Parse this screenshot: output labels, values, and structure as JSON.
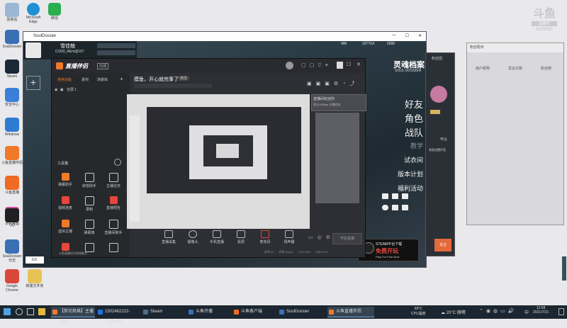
{
  "desktop": {
    "icons": [
      {
        "label": "回收站",
        "color": "#9bb7d4"
      },
      {
        "label": "Microsoft Edge",
        "color": "#1f8fd6"
      },
      {
        "label": "微信",
        "color": "#2aae4f"
      },
      {
        "label": "SoulDossier",
        "color": "#3a6fb5"
      },
      {
        "label": "Steam",
        "color": "#1b2838"
      },
      {
        "label": "安全中心",
        "color": "#3b7fd8"
      },
      {
        "label": "Windows",
        "color": "#2f7bd3"
      },
      {
        "label": "斗鱼直播伴侣",
        "color": "#f07a2a"
      },
      {
        "label": "斗鱼直播",
        "color": "#ef6a22"
      },
      {
        "label": "多彩桌面",
        "color": "#d44ea8"
      },
      {
        "label": "QQ",
        "color": "#202020"
      },
      {
        "label": "SoulDossier日志",
        "color": "#3a6fb5"
      },
      {
        "label": "Google Chrome",
        "color": "#d9473b"
      },
      {
        "label": "新建文件夹",
        "color": "#e7c255"
      }
    ]
  },
  "soul_window": {
    "title": "SoulDossier",
    "player_name": "雪佳柚",
    "player_id": "Cr320_AEm@167",
    "currency": [
      "490",
      "1377XX",
      "2000"
    ],
    "nav": [
      "好友",
      "角色",
      "战队",
      "教学",
      "试衣间",
      "版本计划",
      "福利活动"
    ],
    "logo_text": "灵魂档案",
    "logo_sub": "SOUL DOSSIER",
    "game_label": "STEAM平台下载",
    "game_title": "免费开玩",
    "game_sub": "Play For Free Now"
  },
  "live_window": {
    "brand": "直播伴侣",
    "brand_tag": "内测",
    "stream_title": "摸鱼，开心就完事了",
    "edit_label": "修改",
    "tabs": [
      "常用功能",
      "素材",
      "场景库"
    ],
    "scene_label": "全屏 1",
    "tools_title": "工具箱",
    "tools": [
      "弹幕助手",
      "房管助手",
      "主播任务",
      "视频连麦",
      "录制",
      "直播预告",
      "虚拟主播",
      "弹幕墙",
      "直播间助手",
      "小窗口",
      "连麦",
      "更多"
    ],
    "controls": [
      "直播采集",
      "摄像头",
      "手机直播",
      "投屏",
      "麦克风",
      "扬声器"
    ],
    "start_button": "开始直播",
    "status": [
      "帧率:60",
      "码率:0kbps",
      "CPU:33%",
      "内存:51%",
      "丢帧:0"
    ],
    "chat_note": "直播间欢迎你",
    "chat_sub": "积分1000ge 主播任务",
    "tip": "斗鱼直播伴侣视频聚合"
  },
  "right_panel": {
    "title": "粉丝助手",
    "cols": [
      "用户昵称",
      "发言次数",
      "粉丝牌"
    ]
  },
  "soul_side": {
    "items": [
      "粉丝团",
      "可以",
      "发现设置声音"
    ],
    "button": "关注"
  },
  "watermark": {
    "brand": "斗鱼",
    "tag": "直播号",
    "id": "6169355"
  },
  "taskbar": {
    "tasks": [
      {
        "label": "【剪切风格】主播形象...",
        "color": "#f07a2a"
      },
      {
        "label": "1502462222-YM6WW...",
        "color": "#1a73e8"
      },
      {
        "label": "Steam",
        "color": "#1b2838"
      },
      {
        "label": "斗鱼开播",
        "color": "#3a6fb5"
      },
      {
        "label": "斗鱼客户端",
        "color": "#ef6a22"
      },
      {
        "label": "SoulDossier",
        "color": "#3a6fb5"
      },
      {
        "label": "斗鱼直播伴侣",
        "color": "#f07a2a"
      }
    ],
    "weather": "20°C 微晴",
    "cpu_temp": "69°C",
    "cpu_label": "CPU温度",
    "time": "12:58",
    "date": "2021/7/21",
    "lang": "中"
  },
  "colors": {
    "accent": "#f07a2a",
    "brand_red": "#d8373a"
  }
}
